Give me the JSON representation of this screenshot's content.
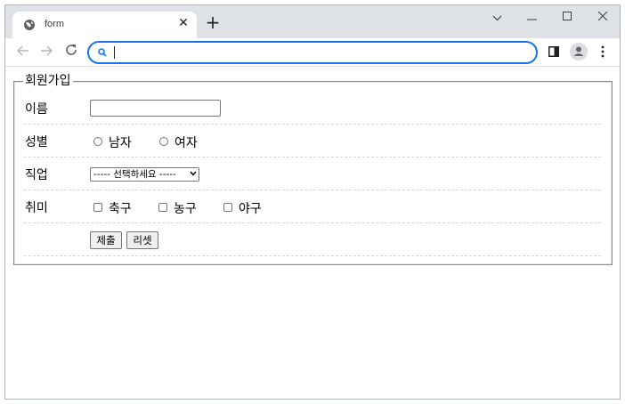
{
  "browser": {
    "tab_title": "form",
    "tab_close": "✕",
    "new_tab": "+",
    "address_value": "",
    "window_controls": {
      "menu": "⌄",
      "minimize": "—",
      "maximize": "☐",
      "close": "✕"
    }
  },
  "form": {
    "legend": "회원가입",
    "name_label": "이름",
    "name_value": "",
    "gender_label": "성별",
    "gender_options": [
      "남자",
      "여자"
    ],
    "job_label": "직업",
    "job_selected": "----- 선택하세요 -----",
    "hobby_label": "취미",
    "hobby_options": [
      "축구",
      "농구",
      "야구"
    ],
    "submit_label": "제출",
    "reset_label": "리셋"
  },
  "colors": {
    "accent": "#1a73e8",
    "tabstrip": "#dee1e6"
  }
}
